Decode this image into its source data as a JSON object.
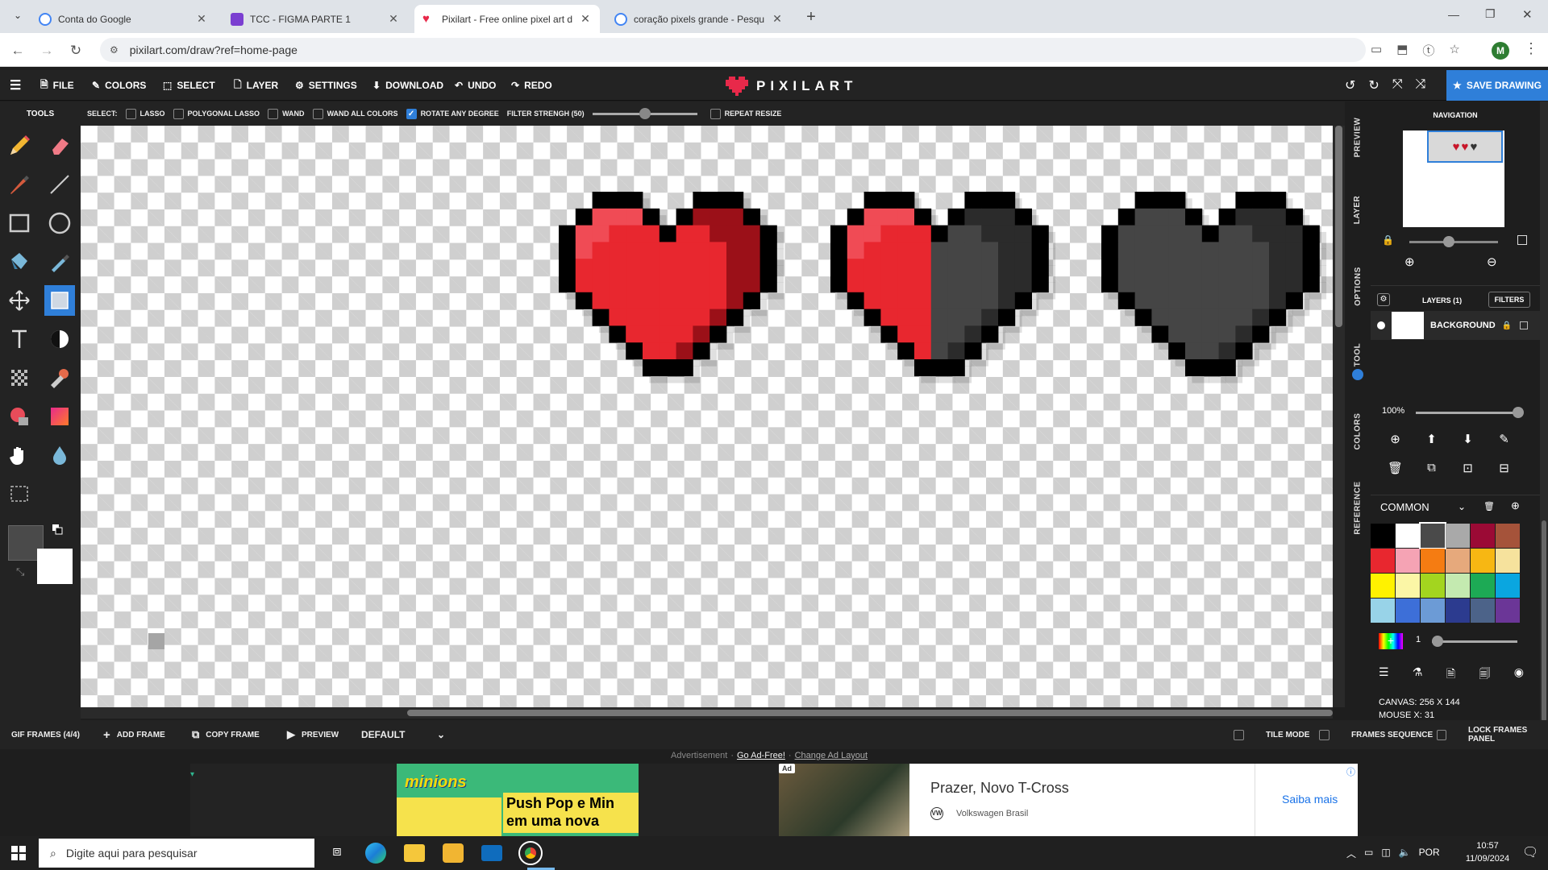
{
  "browser": {
    "tabs": [
      {
        "title": "Conta do Google",
        "favicon_color": "#4285f4"
      },
      {
        "title": "TCC - FIGMA PARTE 1",
        "favicon_color": "#7b3fd1"
      },
      {
        "title": "Pixilart - Free online pixel art d",
        "favicon_color": "#e8294a"
      },
      {
        "title": "coração pixels grande - Pesquis",
        "favicon_color": "#4285f4"
      }
    ],
    "url": "pixilart.com/draw?ref=home-page",
    "profile_initial": "M"
  },
  "app": {
    "logo": "PIXILART",
    "menu": {
      "file": "FILE",
      "colors": "COLORS",
      "select": "SELECT",
      "layer": "LAYER",
      "settings": "SETTINGS",
      "download": "DOWNLOAD",
      "undo": "UNDO",
      "redo": "REDO"
    },
    "save_label": "SAVE DRAWING",
    "tools_title": "TOOLS",
    "select_options": {
      "prefix": "SELECT:",
      "lasso": "LASSO",
      "polygonal_lasso": "POLYGONAL LASSO",
      "wand": "WAND",
      "wand_all_colors": "WAND ALL COLORS",
      "rotate_any_degree": "ROTATE ANY DEGREE",
      "filter_strength": "FILTER STRENGH (50)",
      "repeat_resize": "REPEAT RESIZE",
      "filter_strength_value": 0.5
    },
    "side_tabs": {
      "preview": "PREVIEW",
      "layer": "LAYER",
      "options": "OPTIONS",
      "tool": "TOOL",
      "colors": "COLORS",
      "reference": "REFERENCE"
    },
    "navigation_title": "NAVIGATION",
    "layers": {
      "title": "LAYERS (1)",
      "filters_label": "FILTERS",
      "layer_name": "BACKGROUND",
      "opacity": "100%"
    },
    "palette": {
      "name": "COMMON",
      "colors": [
        "#000000",
        "#ffffff",
        "#4a4a4a",
        "#a9a9a9",
        "#9b0a35",
        "#a5533a",
        "#e8272f",
        "#f5a3b4",
        "#f57c12",
        "#e6a97c",
        "#f7b713",
        "#f6e29d",
        "#fff200",
        "#fbf6a6",
        "#a3d51f",
        "#c4eab0",
        "#1daa55",
        "#0aa6e0",
        "#98d3e8",
        "#3d6fd8",
        "#6c9bd6",
        "#2c3b8f",
        "#4c6389",
        "#6b3697"
      ],
      "brush_size": "1"
    },
    "canvas_info": {
      "size": "CANVAS: 256 X 144",
      "mouse": "MOUSE X: 31"
    },
    "frames": {
      "gif_frames": "GIF FRAMES (4/4)",
      "add_frame": "ADD FRAME",
      "copy_frame": "COPY FRAME",
      "preview": "PREVIEW",
      "mode": "DEFAULT",
      "tile_mode": "TILE MODE",
      "frames_sequence": "FRAMES SEQUENCE",
      "lock_frames_panel": "LOCK FRAMES PANEL"
    }
  },
  "ad": {
    "advertisement": "Advertisement",
    "go_ad_free": "Go Ad-Free!",
    "change_layout": "Change Ad Layout",
    "left_brand": "minions",
    "left_line1": "Push Pop e Min",
    "left_line2": "em uma nova",
    "ad_badge": "Ad",
    "title": "Prazer, Novo T-Cross",
    "advertiser": "Volkswagen Brasil",
    "cta": "Saiba mais"
  },
  "taskbar": {
    "search_placeholder": "Digite aqui para pesquisar",
    "lang": "POR",
    "time": "10:57",
    "date": "11/09/2024"
  },
  "colors": {
    "accent": "#2f7fd9",
    "heart_red": "#e8272f",
    "heart_dark_red": "#9b1018",
    "heart_gray": "#454545",
    "heart_gray_dark": "#2b2b2b"
  },
  "icons": [
    "hamburger-icon",
    "file-icon",
    "brush-icon",
    "select-icon",
    "layer-icon",
    "gear-icon",
    "download-icon",
    "undo-icon",
    "redo-icon",
    "heart-logo-icon",
    "pencil-icon",
    "eraser-icon",
    "line-icon",
    "rectangle-icon",
    "circle-icon",
    "bucket-icon",
    "eyedropper-icon",
    "move-icon",
    "text-icon",
    "dither-icon",
    "stamp-icon",
    "gradient-icon",
    "hand-icon",
    "blur-icon",
    "crop-icon",
    "zoom-in-icon",
    "zoom-out-icon"
  ]
}
